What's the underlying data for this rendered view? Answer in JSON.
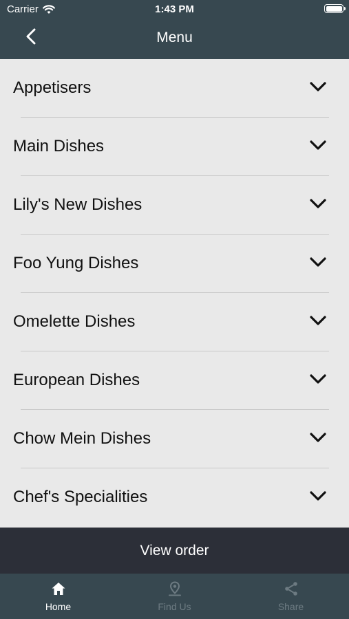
{
  "status_bar": {
    "carrier": "Carrier",
    "time": "1:43 PM"
  },
  "header": {
    "title": "Menu"
  },
  "menu": {
    "categories": [
      {
        "label": "Appetisers"
      },
      {
        "label": "Main Dishes"
      },
      {
        "label": "Lily's New Dishes"
      },
      {
        "label": "Foo Yung Dishes"
      },
      {
        "label": "Omelette Dishes"
      },
      {
        "label": "European Dishes"
      },
      {
        "label": "Chow Mein Dishes"
      },
      {
        "label": "Chef's Specialities"
      }
    ]
  },
  "order": {
    "view_label": "View order"
  },
  "tabbar": {
    "tabs": [
      {
        "label": "Home",
        "icon": "home-icon",
        "active": true
      },
      {
        "label": "Find Us",
        "icon": "map-pin-icon",
        "active": false
      },
      {
        "label": "Share",
        "icon": "share-icon",
        "active": false
      }
    ]
  },
  "colors": {
    "header_bg": "#374850",
    "list_bg": "#e9e9e9",
    "order_bar_bg": "#2c2f38",
    "inactive_tab": "#6d7b82"
  }
}
